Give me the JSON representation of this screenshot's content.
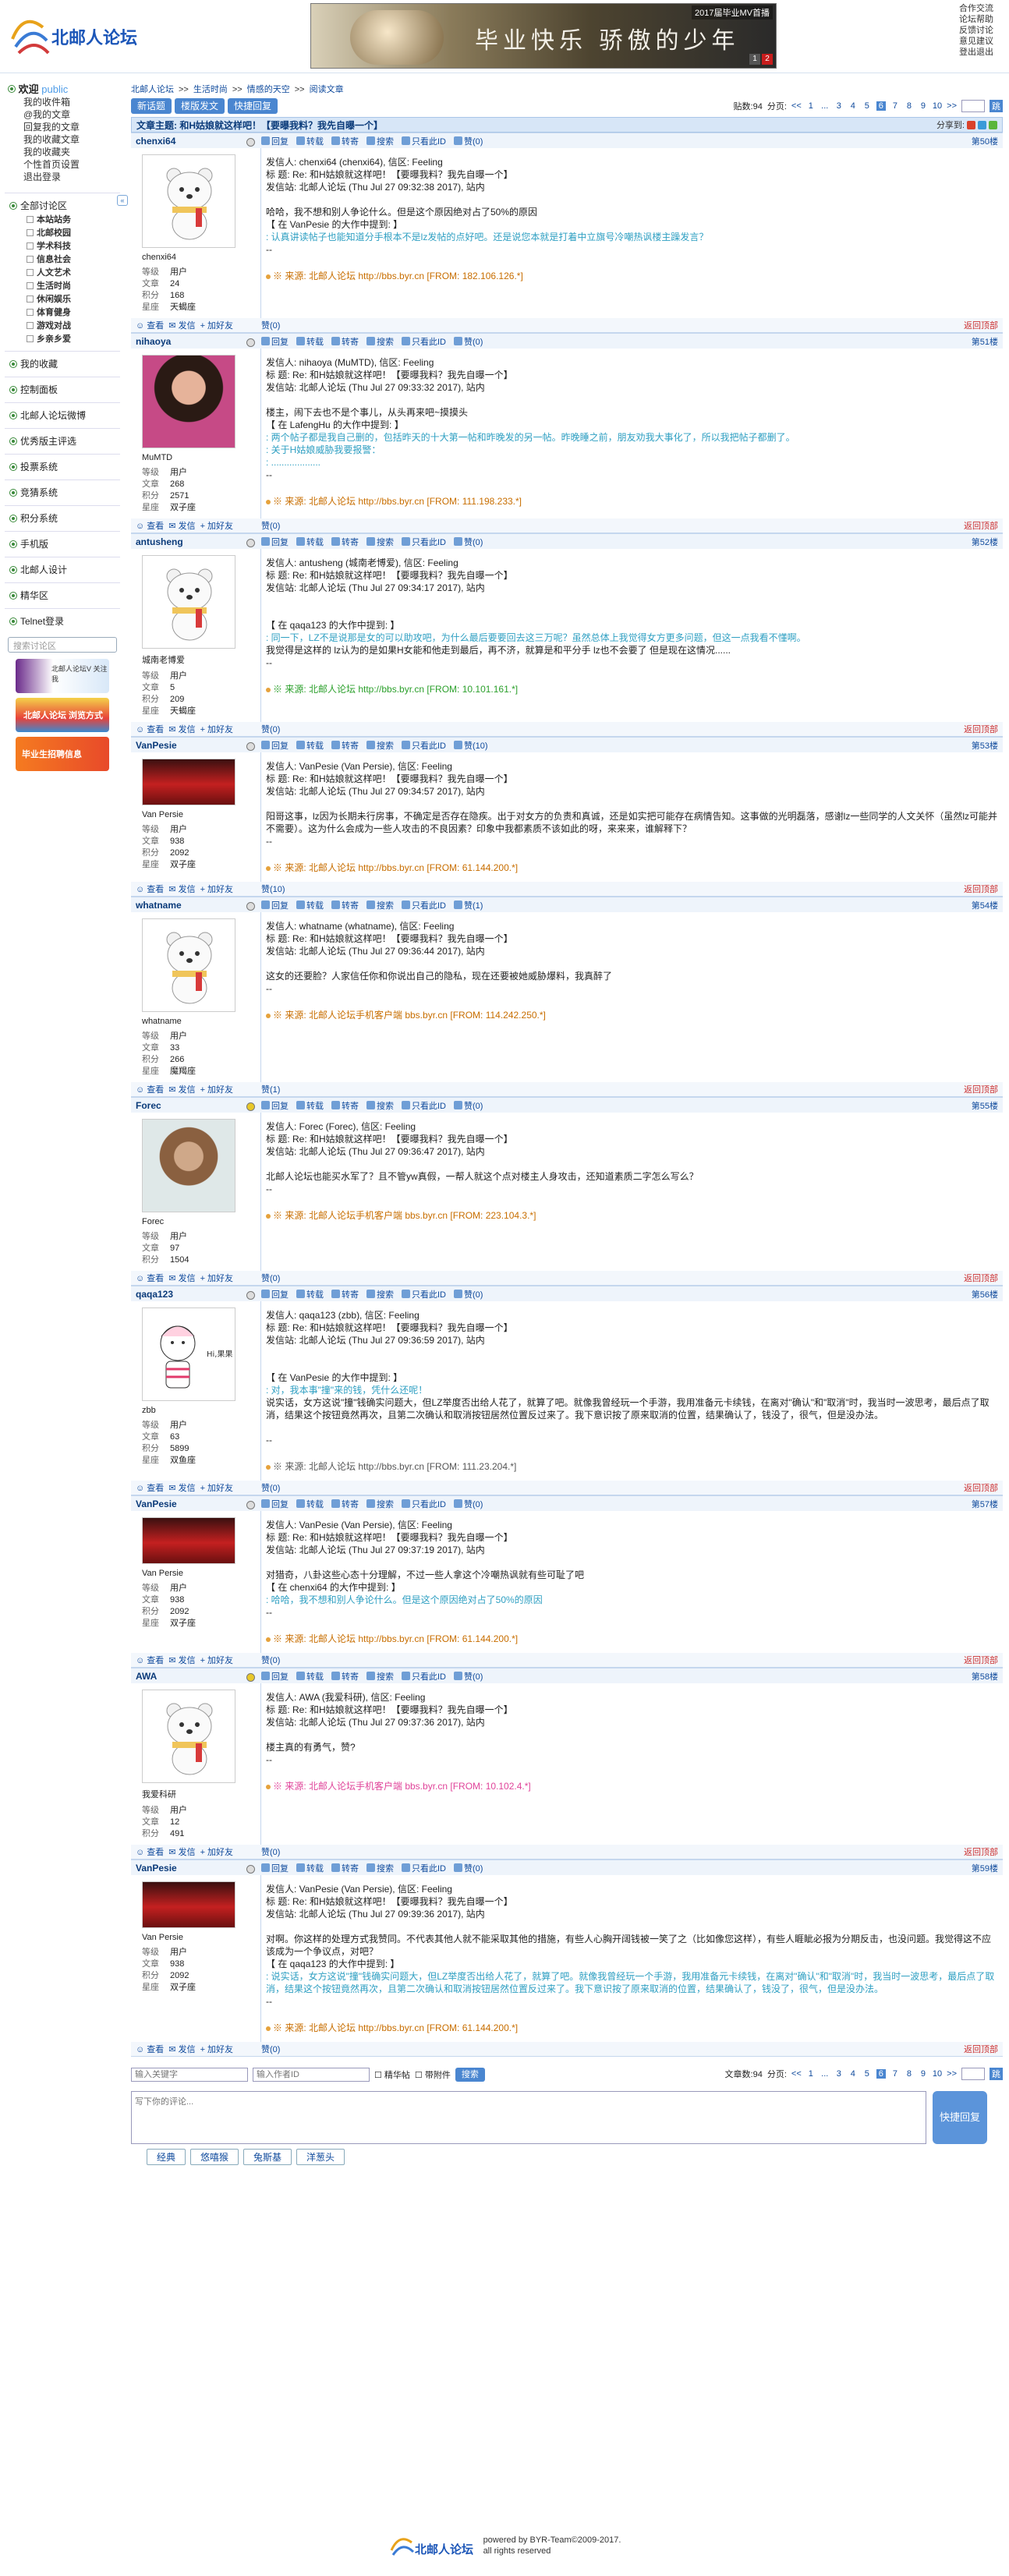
{
  "site": {
    "logo_text": "北邮人论坛",
    "banner_text": "毕业快乐 骄傲的少年",
    "banner_tag": "2017届毕业MV首播",
    "banner_pages": [
      "1",
      "2"
    ]
  },
  "top_links": [
    "合作交流",
    "论坛帮助",
    "反馈讨论",
    "意见建议",
    "登出退出"
  ],
  "sidebar": {
    "welcome": "欢迎",
    "user": "public",
    "user_links": [
      "我的收件箱",
      "@我的文章",
      "回复我的文章",
      "我的收藏文章",
      "我的收藏夹",
      "个性首页设置",
      "退出登录"
    ],
    "sections_title": "全部讨论区",
    "sections": [
      "本站站务",
      "北邮校园",
      "学术科技",
      "信息社会",
      "人文艺术",
      "生活时尚",
      "休闲娱乐",
      "体育健身",
      "游戏对战",
      "乡亲乡爱"
    ],
    "menus": [
      "我的收藏",
      "控制面板",
      "北邮人论坛微博",
      "优秀版主评选",
      "投票系统",
      "竞猜系统",
      "积分系统",
      "手机版",
      "北邮人设计",
      "精华区",
      "Telnet登录"
    ],
    "search_placeholder": "搜索讨论区",
    "ads": [
      "北邮人论坛V 关注我",
      "北邮人论坛 浏览方式",
      "毕业生招聘信息"
    ],
    "collapse": "«"
  },
  "breadcrumb": [
    "北邮人论坛",
    ">>",
    "生活时尚",
    ">>",
    "情感的天空",
    ">>",
    "阅读文章"
  ],
  "toolbar": {
    "new": "新话题",
    "layout": "楼版发文",
    "quick": "快捷回复"
  },
  "pager": {
    "label": "贴数:94",
    "pageLabel": "分页:",
    "prev": "<<",
    "pages": [
      "1",
      "...",
      "3",
      "4",
      "5",
      "6",
      "7",
      "8",
      "9",
      "10"
    ],
    "current": "6",
    "next": ">>",
    "go": "跳"
  },
  "bottom_pager": {
    "label": "文章数:94",
    "pageLabel": "分页:"
  },
  "title": "文章主题: 和H姑娘就这样吧！【要曝我料？我先自曝一个】",
  "share_label": "分享到:",
  "action_labels": [
    "回复",
    "转载",
    "转寄",
    "搜索",
    "只看此ID",
    "赞(0)"
  ],
  "post_foot": {
    "view": "查看",
    "mail": "发信",
    "friend": "加好友",
    "top": "返回顶部"
  },
  "stat_keys": {
    "level": "等级",
    "posts": "文章",
    "score": "积分",
    "star": "星座"
  },
  "posts": [
    {
      "user": "chenxi64",
      "nick": "chenxi64",
      "floor": "第50楼",
      "online": false,
      "level": "用户",
      "posts": "24",
      "score": "168",
      "star": "天蝎座",
      "likes": "赞(0)",
      "lines": [
        "发信人: chenxi64 (chenxi64), 信区: Feeling",
        "标  题: Re: 和H姑娘就这样吧！【要曝我料？我先自曝一个】",
        "发信站: 北邮人论坛 (Thu Jul 27 09:32:38 2017), 站内",
        "",
        "哈哈，我不想和别人争论什么。但是这个原因绝对占了50%的原因",
        "【 在 VanPesie 的大作中提到: 】"
      ],
      "quote": [
        ": 认真讲读帖子也能知道分手根本不是lz发帖的点好吧。还是说您本就是打着中立旗号冷嘲热讽楼主躁发言？"
      ],
      "after": [
        "--"
      ],
      "src": "※ 来源: 北邮人论坛 http://bbs.byr.cn [FROM: 182.106.126.*]",
      "avatar": "bear"
    },
    {
      "user": "nihaoya",
      "nick": "MuMTD",
      "floor": "第51楼",
      "online": false,
      "level": "用户",
      "posts": "268",
      "score": "2571",
      "star": "双子座",
      "likes": "赞(0)",
      "lines": [
        "发信人: nihaoya (MuMTD), 信区: Feeling",
        "标  题: Re: 和H姑娘就这样吧！【要曝我料？我先自曝一个】",
        "发信站: 北邮人论坛 (Thu Jul 27 09:33:32 2017), 站内",
        "",
        "楼主，闹下去也不是个事儿，从头再来吧~摸摸头",
        "【 在 LafengHu 的大作中提到: 】"
      ],
      "quote": [
        ": 两个帖子都是我自己删的，包括昨天的十大第一帖和昨晚发的另一帖。昨晚睡之前，朋友劝我大事化了，所以我把帖子都删了。",
        ": 关于H姑娘威胁我要报警：",
        ": ..................."
      ],
      "after": [
        "--"
      ],
      "src": "※ 来源: 北邮人论坛 http://bbs.byr.cn [FROM: 111.198.233.*]",
      "avatar": "photo-woman"
    },
    {
      "user": "antusheng",
      "nick": "城南老博爱",
      "floor": "第52楼",
      "online": false,
      "level": "用户",
      "posts": "5",
      "score": "209",
      "star": "天蝎座",
      "likes": "赞(0)",
      "lines": [
        "发信人: antusheng (城南老博爱), 信区: Feeling",
        "标  题: Re: 和H姑娘就这样吧！【要曝我料？我先自曝一个】",
        "发信站: 北邮人论坛 (Thu Jul 27 09:34:17 2017), 站内",
        "",
        "",
        "【 在 qaqa123 的大作中提到: 】"
      ],
      "quote": [
        ": 同一下，LZ不是说那是女的可以助攻吧，为什么最后要要回去这三万呢？虽然总体上我觉得女方更多问题，但这一点我看不懂啊。"
      ],
      "after": [
        "我觉得是这样的  lz认为的是如果H女能和他走到最后，再不济，就算是和平分手 lz也不会要了  但是现在这情况......",
        "--"
      ],
      "src": "※ 来源: 北邮人论坛 http://bbs.byr.cn [FROM: 10.101.161.*]",
      "avatar": "bear",
      "src_green": true
    },
    {
      "user": "VanPesie",
      "nick": "Van Persie",
      "floor": "第53楼",
      "online": false,
      "level": "用户",
      "posts": "938",
      "score": "2092",
      "star": "双子座",
      "likes": "赞(10)",
      "lines": [
        "发信人: VanPesie (Van Persie), 信区: Feeling",
        "标  题: Re: 和H姑娘就这样吧！【要曝我料？我先自曝一个】",
        "发信站: 北邮人论坛 (Thu Jul 27 09:34:57 2017), 站内",
        "",
        "阳哥这事，lz因为长期未行房事，不确定是否存在隐疾。出于对女方的负责和真诚，还是如实把可能存在病情告知。这事做的光明磊落，感谢lz一些同学的人文关怀（虽然lz可能并不需要）。这为什么会成为一些人攻击的不良因素？印象中我都素质不该如此的呀，来来来，谁解释下？",
        "--"
      ],
      "quote": [],
      "after": [],
      "src": "※ 来源: 北邮人论坛 http://bbs.byr.cn [FROM: 61.144.200.*]",
      "avatar": "photo-red",
      "zan": "赞(10)"
    },
    {
      "user": "whatname",
      "nick": "whatname",
      "floor": "第54楼",
      "online": false,
      "level": "用户",
      "posts": "33",
      "score": "266",
      "star": "魔羯座",
      "likes": "赞(1)",
      "lines": [
        "发信人: whatname (whatname), 信区: Feeling",
        "标  题: Re: 和H姑娘就这样吧！【要曝我料？我先自曝一个】",
        "发信站: 北邮人论坛 (Thu Jul 27 09:36:44 2017), 站内",
        "",
        "这女的还要脸？人家信任你和你说出自己的隐私，现在还要被她威胁爆料，我真醉了",
        "--"
      ],
      "quote": [],
      "after": [],
      "src": "※ 来源: 北邮人论坛手机客户端 bbs.byr.cn [FROM: 114.242.250.*]",
      "avatar": "bear",
      "zan": "赞(1)",
      "mobile": true
    },
    {
      "user": "Forec",
      "nick": "Forec",
      "floor": "第55楼",
      "online": true,
      "level": "用户",
      "posts": "97",
      "score": "1504",
      "star": "",
      "likes": "赞(0)",
      "lines": [
        "发信人: Forec (Forec), 信区: Feeling",
        "标  题: Re: 和H姑娘就这样吧！【要曝我料？我先自曝一个】",
        "发信站: 北邮人论坛 (Thu Jul 27 09:36:47 2017), 站内",
        "",
        "北邮人论坛也能买水军了？且不管yw真假，一帮人就这个点对楼主人身攻击，还知道素质二字怎么写么？",
        "--"
      ],
      "quote": [],
      "after": [],
      "src": "※ 来源: 北邮人论坛手机客户端 bbs.byr.cn [FROM: 223.104.3.*]",
      "avatar": "wolf",
      "mobile": true
    },
    {
      "user": "qaqa123",
      "nick": "zbb",
      "floor": "第56楼",
      "online": false,
      "level": "用户",
      "posts": "63",
      "score": "5899",
      "star": "双鱼座",
      "likes": "赞(0)",
      "lines": [
        "发信人: qaqa123 (zbb), 信区: Feeling",
        "标  题: Re: 和H姑娘就这样吧！【要曝我料？我先自曝一个】",
        "发信站: 北邮人论坛 (Thu Jul 27 09:36:59 2017), 站内",
        "",
        "",
        "【 在 VanPesie 的大作中提到: 】"
      ],
      "quote": [
        ": 对，我本事\"撞\"来的钱，凭什么还呢！"
      ],
      "after": [
        "说实话，女方这说\"撞\"钱确实问题大，但LZ举度否出给人花了，就算了吧。就像我曾经玩一个手游，我用准备元卡续钱，在离对\"确认\"和\"取消\"时，我当时一波思考，最后点了取消，结果这个按钮竟然再次，且第二次确认和取消按钮居然位置反过来了。我下意识按了原来取消的位置，结果确认了，钱没了，很气，但是没办法。",
        "",
        "--"
      ],
      "src": "※ 来源: 北邮人论坛 http://bbs.byr.cn [FROM: 111.23.204.*]",
      "avatar": "girl",
      "src_plain": true
    },
    {
      "user": "VanPesie",
      "nick": "Van Persie",
      "floor": "第57楼",
      "online": false,
      "level": "用户",
      "posts": "938",
      "score": "2092",
      "star": "双子座",
      "likes": "赞(0)",
      "lines": [
        "发信人: VanPesie (Van Persie), 信区: Feeling",
        "标  题: Re: 和H姑娘就这样吧！【要曝我料？我先自曝一个】",
        "发信站: 北邮人论坛 (Thu Jul 27 09:37:19 2017), 站内",
        "",
        "对猎奇，八卦这些心态十分理解，不过一些人拿这个冷嘲热讽就有些可耻了吧",
        "【 在 chenxi64 的大作中提到: 】"
      ],
      "quote": [
        ": 哈哈，我不想和别人争论什么。但是这个原因绝对占了50%的原因"
      ],
      "after": [
        "--"
      ],
      "src": "※ 来源: 北邮人论坛 http://bbs.byr.cn [FROM: 61.144.200.*]",
      "avatar": "photo-red"
    },
    {
      "user": "AWA",
      "nick": "我爱科研",
      "floor": "第58楼",
      "online": true,
      "level": "用户",
      "posts": "12",
      "score": "491",
      "star": "",
      "likes": "赞(0)",
      "lines": [
        "发信人: AWA (我爱科研), 信区: Feeling",
        "标  题: Re: 和H姑娘就这样吧！【要曝我料？我先自曝一个】",
        "发信站: 北邮人论坛 (Thu Jul 27 09:37:36 2017), 站内",
        "",
        "楼主真的有勇气，赞?",
        "--"
      ],
      "quote": [],
      "after": [],
      "src": "※ 来源: 北邮人论坛手机客户端 bbs.byr.cn [FROM: 10.102.4.*]",
      "avatar": "bear",
      "mobile": true,
      "src_pink": true
    },
    {
      "user": "VanPesie",
      "nick": "Van Persie",
      "floor": "第59楼",
      "online": false,
      "level": "用户",
      "posts": "938",
      "score": "2092",
      "star": "双子座",
      "likes": "赞(0)",
      "lines": [
        "发信人: VanPesie (Van Persie), 信区: Feeling",
        "标  题: Re: 和H姑娘就这样吧！【要曝我料？我先自曝一个】",
        "发信站: 北邮人论坛 (Thu Jul 27 09:39:36 2017), 站内",
        "",
        "对啊。你这样的处理方式我赞同。不代表其他人就不能采取其他的措施，有些人心胸开阔钱被一笑了之（比如像您这样），有些人睚眦必报为分期反击，也没问题。我觉得这不应该成为一个争议点，对吧？",
        "【 在 qaqa123 的大作中提到: 】"
      ],
      "quote": [
        ": 说实话，女方这说\"撞\"钱确实问题大，但LZ举度否出给人花了，就算了吧。就像我曾经玩一个手游，我用准备元卡续钱，在离对\"确认\"和\"取消\"时，我当时一波思考，最后点了取消，结果这个按钮竟然再次，且第二次确认和取消按钮居然位置反过来了。我下意识按了原来取消的位置，结果确认了，钱没了，很气，但是没办法。"
      ],
      "after": [
        "--"
      ],
      "src": "※ 来源: 北邮人论坛 http://bbs.byr.cn [FROM: 61.144.200.*]",
      "avatar": "photo-red"
    }
  ],
  "bottom": {
    "keyword_placeholder": "输入关键字",
    "author_placeholder": "输入作者ID",
    "only_jing": "精华帖",
    "has_att": "带附件",
    "search_btn": "搜索"
  },
  "reply": {
    "placeholder": "写下你的评论...",
    "send": "快捷回复",
    "emotes": [
      "经典",
      "悠嘻猴",
      "兔斯基",
      "洋葱头"
    ]
  },
  "footer": {
    "powered": "powered by BYR-Team©2009-2017.",
    "rights": "all rights reserved"
  },
  "colors": {
    "accent": "#4a86d0",
    "header_bg": "#d7e6f7",
    "quote": "#2e9fc2",
    "source": "#c86e00"
  }
}
